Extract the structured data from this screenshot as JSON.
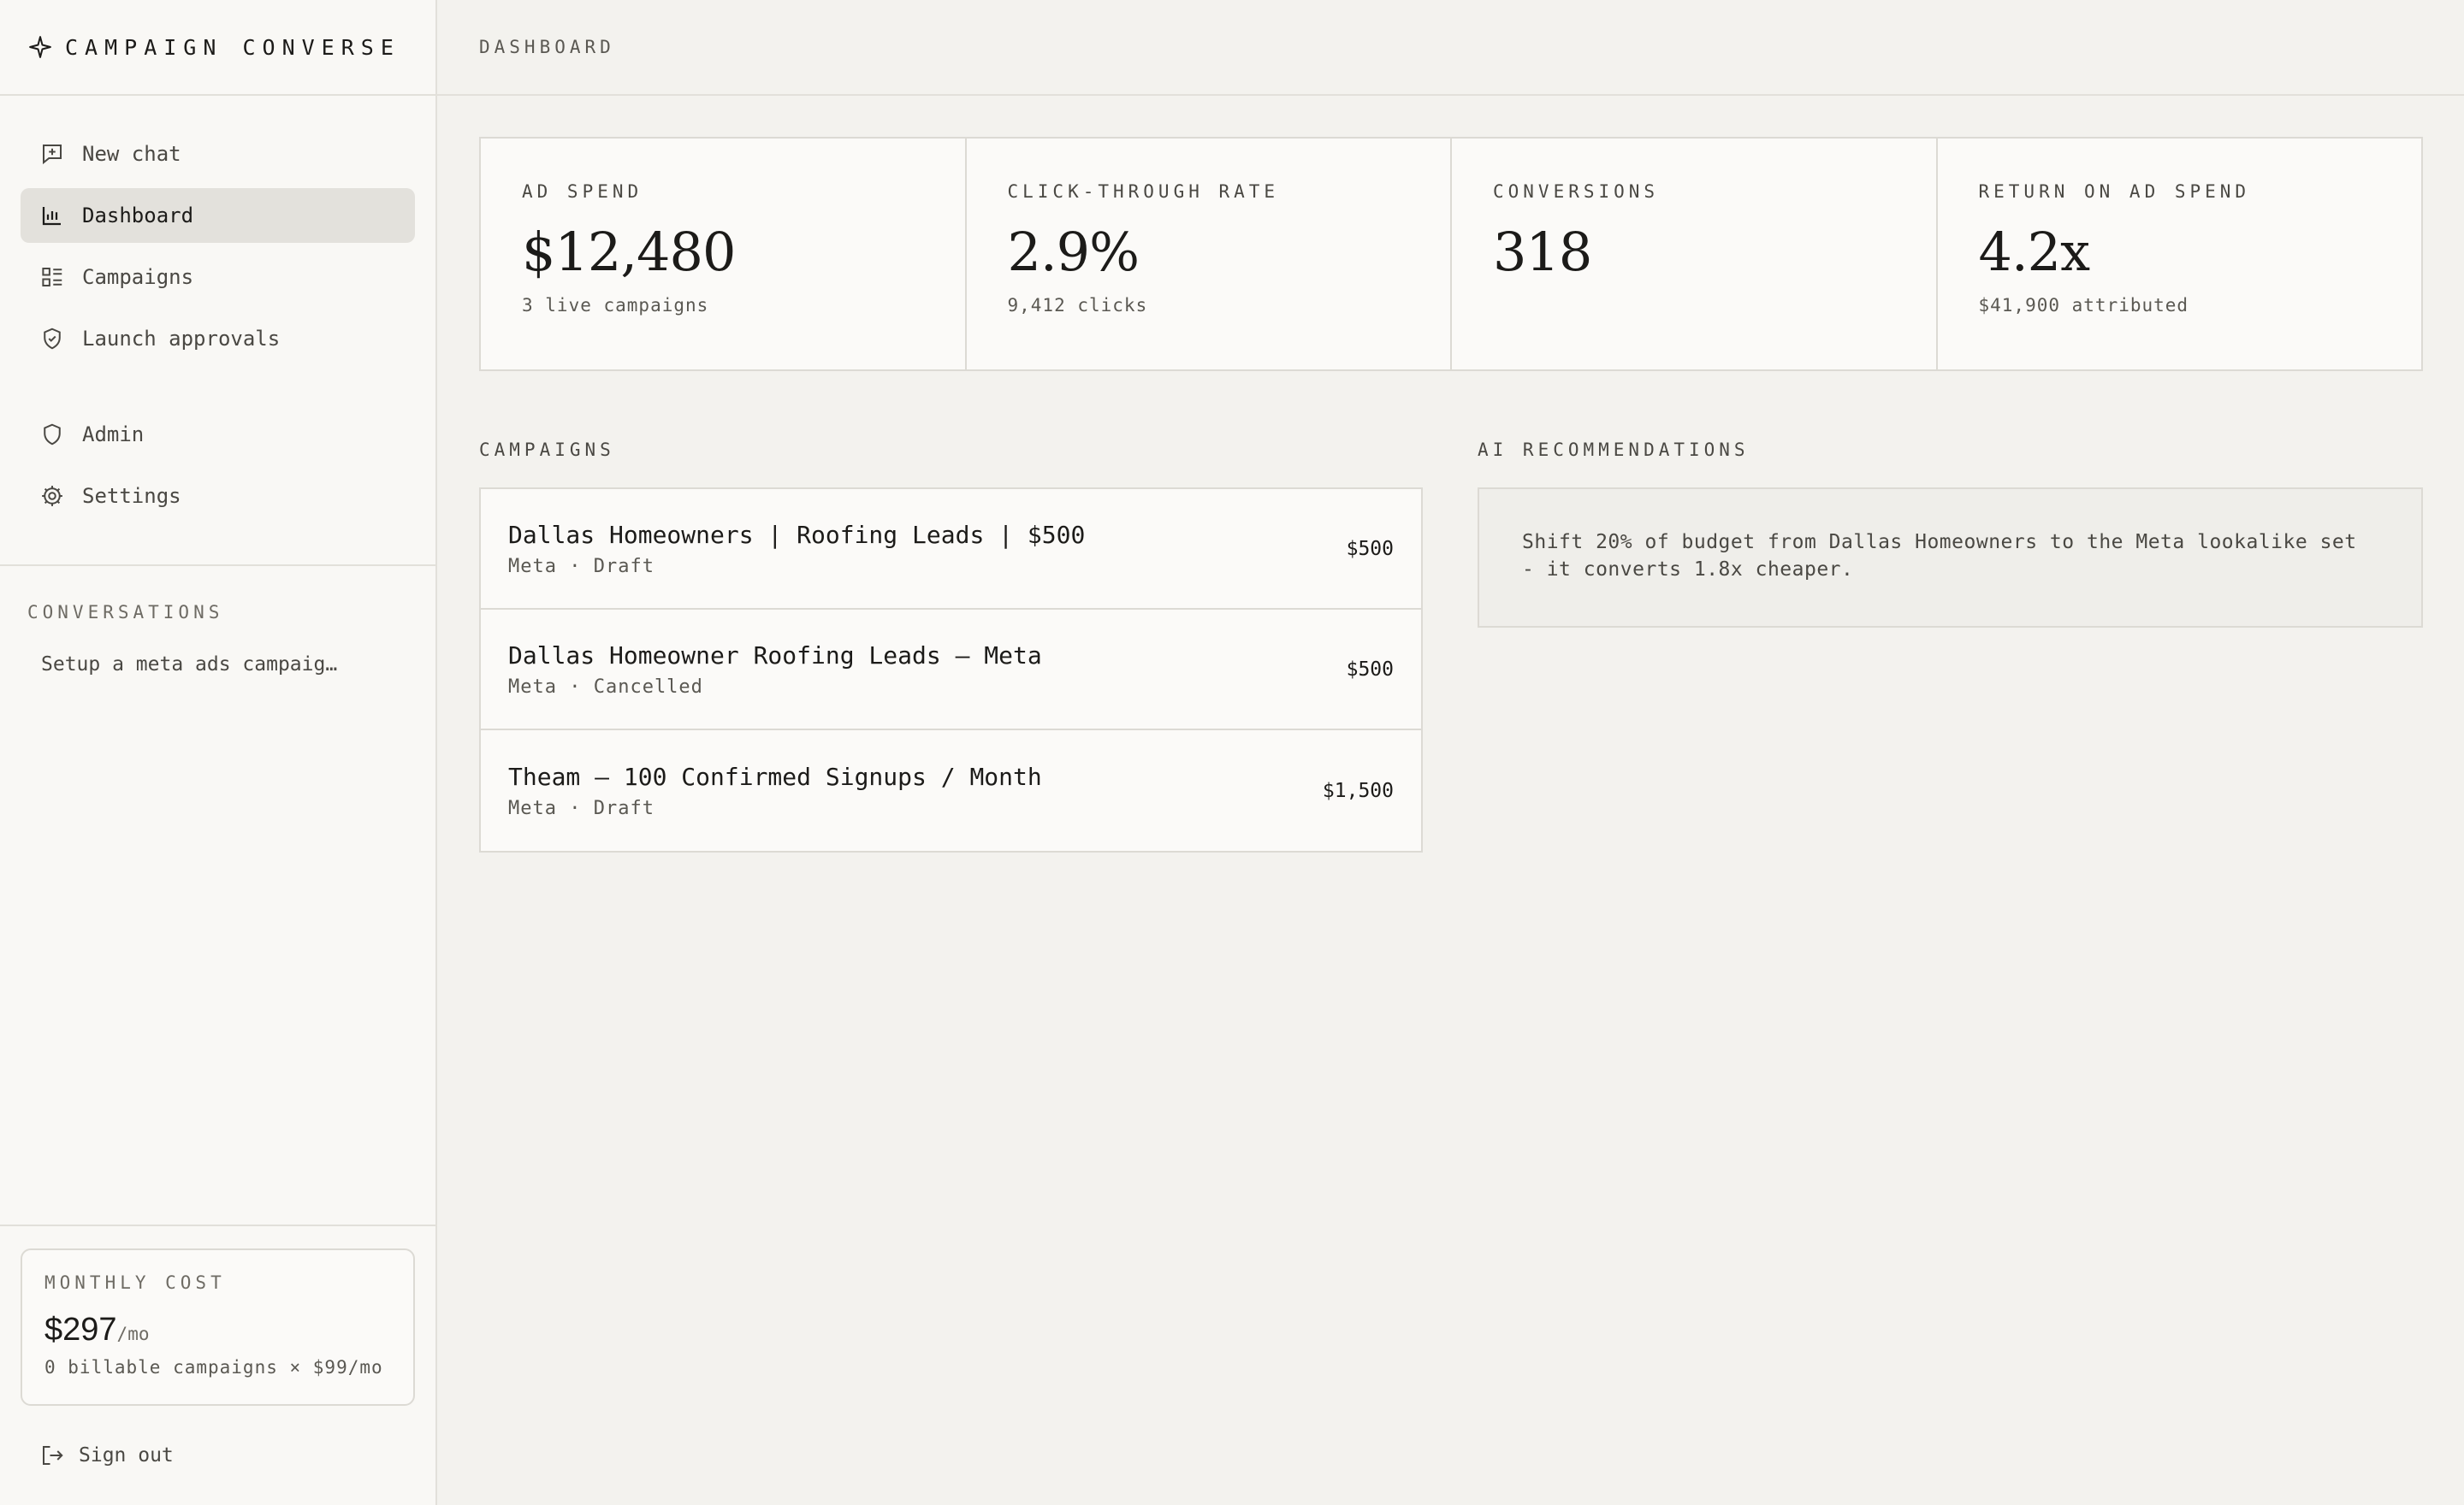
{
  "brand": {
    "name": "CAMPAIGN CONVERSE",
    "icon": "sparkle-icon"
  },
  "nav": {
    "items": [
      {
        "label": "New chat",
        "icon": "chat-plus-icon"
      },
      {
        "label": "Dashboard",
        "icon": "bar-chart-icon",
        "active": true
      },
      {
        "label": "Campaigns",
        "icon": "list-icon"
      },
      {
        "label": "Launch approvals",
        "icon": "shield-check-icon"
      }
    ],
    "secondary": [
      {
        "label": "Admin",
        "icon": "shield-icon"
      },
      {
        "label": "Settings",
        "icon": "gear-icon"
      }
    ]
  },
  "conversations": {
    "label": "CONVERSATIONS",
    "items": [
      {
        "label": "Setup a meta ads campaig…"
      }
    ]
  },
  "monthly_cost": {
    "label": "MONTHLY COST",
    "value": "$297",
    "unit": "/mo",
    "note": "0 billable campaigns × $99/mo"
  },
  "signout": {
    "label": "Sign out",
    "icon": "sign-out-icon"
  },
  "header": {
    "title": "DASHBOARD"
  },
  "metrics": [
    {
      "label": "AD SPEND",
      "value": "$12,480",
      "sub": "3 live campaigns"
    },
    {
      "label": "CLICK-THROUGH RATE",
      "value": "2.9%",
      "sub": "9,412 clicks"
    },
    {
      "label": "CONVERSIONS",
      "value": "318",
      "sub": ""
    },
    {
      "label": "RETURN ON AD SPEND",
      "value": "4.2x",
      "sub": "$41,900 attributed"
    }
  ],
  "campaigns": {
    "label": "CAMPAIGNS",
    "rows": [
      {
        "name": "Dallas Homeowners | Roofing Leads | $500",
        "meta": "Meta · Draft",
        "budget": "$500"
      },
      {
        "name": "Dallas Homeowner Roofing Leads — Meta",
        "meta": "Meta · Cancelled",
        "budget": "$500"
      },
      {
        "name": "Theam — 100 Confirmed Signups / Month",
        "meta": "Meta · Draft",
        "budget": "$1,500"
      }
    ]
  },
  "recommendations": {
    "label": "AI RECOMMENDATIONS",
    "items": [
      {
        "text": "Shift 20% of budget from Dallas Homeowners to the Meta lookalike set - it converts 1.8x cheaper."
      }
    ]
  },
  "colors": {
    "background": "#f3f2ee",
    "sidebar": "#f9f8f5",
    "active_nav": "#e3e1dc",
    "text": "#1c1b19",
    "border": "#dcdad4"
  }
}
